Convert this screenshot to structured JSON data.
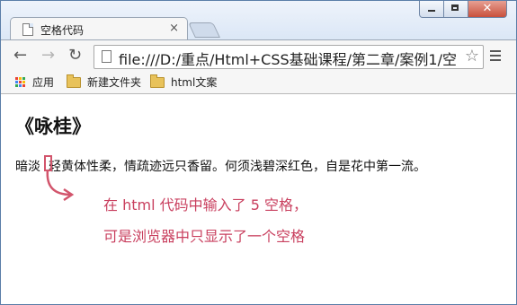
{
  "tab": {
    "title": "空格代码",
    "close_glyph": "×"
  },
  "toolbar": {
    "back_glyph": "←",
    "forward_glyph": "→",
    "reload_glyph": "↻",
    "url": "file:///D:/重点/Html+CSS基础课程/第二章/案例1/空",
    "star_glyph": "☆"
  },
  "bookmarks": [
    {
      "label": "应用",
      "icon": "apps-icon"
    },
    {
      "label": "新建文件夹",
      "icon": "folder-icon"
    },
    {
      "label": "html文案",
      "icon": "folder-icon"
    }
  ],
  "page": {
    "heading": "《咏桂》",
    "line_before_space": "暗淡",
    "line_after_space": "轻黄体性柔，情疏迹远只香留。何须浅碧深红色，自是花中第一流。",
    "annotation_line1": "在 html 代码中输入了 5 空格，",
    "annotation_line2": "可是浏览器中只显示了一个空格"
  },
  "colors": {
    "annotation": "#c9405f",
    "highlight_box": "#d2556c",
    "apps_grid": [
      "#e94335",
      "#fbbc05",
      "#34a853",
      "#4285f4",
      "#ea4335",
      "#fbbc05",
      "#34a853",
      "#4285f4",
      "#e94335"
    ]
  }
}
